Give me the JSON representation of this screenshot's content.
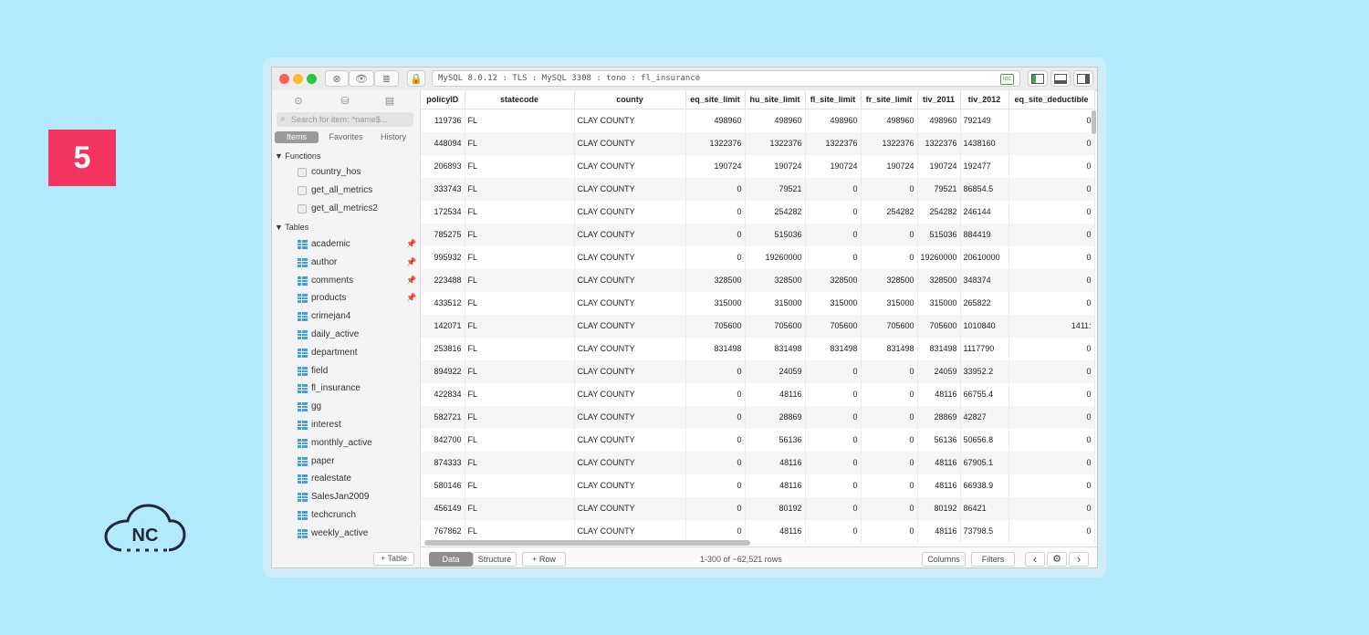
{
  "badge": "5",
  "logo_text": "NC",
  "connection": "MySQL 8.0.12 : TLS : MySQL 3308 : tono : fl_insurance",
  "loc_label": "loc",
  "sidebar": {
    "search_placeholder": "Search for item: ^name$...",
    "segments": [
      "Items",
      "Favorites",
      "History"
    ],
    "functions_label": "Functions",
    "functions": [
      "country_hos",
      "get_all_metrics",
      "get_all_metrics2"
    ],
    "tables_label": "Tables",
    "tables": [
      {
        "name": "academic",
        "pinned": true
      },
      {
        "name": "author",
        "pinned": true
      },
      {
        "name": "comments",
        "pinned": true
      },
      {
        "name": "products",
        "pinned": true
      },
      {
        "name": "crimejan4",
        "pinned": false
      },
      {
        "name": "daily_active",
        "pinned": false
      },
      {
        "name": "department",
        "pinned": false
      },
      {
        "name": "field",
        "pinned": false
      },
      {
        "name": "fl_insurance",
        "pinned": false
      },
      {
        "name": "gg",
        "pinned": false
      },
      {
        "name": "interest",
        "pinned": false
      },
      {
        "name": "monthly_active",
        "pinned": false
      },
      {
        "name": "paper",
        "pinned": false
      },
      {
        "name": "realestate",
        "pinned": false
      },
      {
        "name": "SalesJan2009",
        "pinned": false
      },
      {
        "name": "techcrunch",
        "pinned": false
      },
      {
        "name": "weekly_active",
        "pinned": false
      }
    ],
    "add_table": "+ Table"
  },
  "grid": {
    "columns": [
      "policyID",
      "statecode",
      "county",
      "eq_site_limit",
      "hu_site_limit",
      "fl_site_limit",
      "fr_site_limit",
      "tiv_2011",
      "tiv_2012",
      "eq_site_deductible"
    ],
    "rows": [
      [
        "119736",
        "FL",
        "CLAY COUNTY",
        "498960",
        "498960",
        "498960",
        "498960",
        "498960",
        "792149",
        "0"
      ],
      [
        "448094",
        "FL",
        "CLAY COUNTY",
        "1322376",
        "1322376",
        "1322376",
        "1322376",
        "1322376",
        "1438160",
        "0"
      ],
      [
        "206893",
        "FL",
        "CLAY COUNTY",
        "190724",
        "190724",
        "190724",
        "190724",
        "190724",
        "192477",
        "0"
      ],
      [
        "333743",
        "FL",
        "CLAY COUNTY",
        "0",
        "79521",
        "0",
        "0",
        "79521",
        "86854.5",
        "0"
      ],
      [
        "172534",
        "FL",
        "CLAY COUNTY",
        "0",
        "254282",
        "0",
        "254282",
        "254282",
        "246144",
        "0"
      ],
      [
        "785275",
        "FL",
        "CLAY COUNTY",
        "0",
        "515036",
        "0",
        "0",
        "515036",
        "884419",
        "0"
      ],
      [
        "995932",
        "FL",
        "CLAY COUNTY",
        "0",
        "19260000",
        "0",
        "0",
        "19260000",
        "20610000",
        "0"
      ],
      [
        "223488",
        "FL",
        "CLAY COUNTY",
        "328500",
        "328500",
        "328500",
        "328500",
        "328500",
        "348374",
        "0"
      ],
      [
        "433512",
        "FL",
        "CLAY COUNTY",
        "315000",
        "315000",
        "315000",
        "315000",
        "315000",
        "265822",
        "0"
      ],
      [
        "142071",
        "FL",
        "CLAY COUNTY",
        "705600",
        "705600",
        "705600",
        "705600",
        "705600",
        "1010840",
        "1411:"
      ],
      [
        "253816",
        "FL",
        "CLAY COUNTY",
        "831498",
        "831498",
        "831498",
        "831498",
        "831498",
        "1117790",
        "0"
      ],
      [
        "894922",
        "FL",
        "CLAY COUNTY",
        "0",
        "24059",
        "0",
        "0",
        "24059",
        "33952.2",
        "0"
      ],
      [
        "422834",
        "FL",
        "CLAY COUNTY",
        "0",
        "48116",
        "0",
        "0",
        "48116",
        "66755.4",
        "0"
      ],
      [
        "582721",
        "FL",
        "CLAY COUNTY",
        "0",
        "28869",
        "0",
        "0",
        "28869",
        "42827",
        "0"
      ],
      [
        "842700",
        "FL",
        "CLAY COUNTY",
        "0",
        "56136",
        "0",
        "0",
        "56136",
        "50656.8",
        "0"
      ],
      [
        "874333",
        "FL",
        "CLAY COUNTY",
        "0",
        "48116",
        "0",
        "0",
        "48116",
        "67905.1",
        "0"
      ],
      [
        "580146",
        "FL",
        "CLAY COUNTY",
        "0",
        "48116",
        "0",
        "0",
        "48116",
        "66938.9",
        "0"
      ],
      [
        "456149",
        "FL",
        "CLAY COUNTY",
        "0",
        "80192",
        "0",
        "0",
        "80192",
        "86421",
        "0"
      ],
      [
        "767862",
        "FL",
        "CLAY COUNTY",
        "0",
        "48116",
        "0",
        "0",
        "48116",
        "73798.5",
        "0"
      ]
    ]
  },
  "bottombar": {
    "data_tab": "Data",
    "structure_tab": "Structure",
    "add_row": "+ Row",
    "row_count": "1-300 of ~62,521 rows",
    "columns_btn": "Columns",
    "filters_btn": "Filters",
    "prev": "‹",
    "gear": "⚙",
    "next": "›"
  }
}
